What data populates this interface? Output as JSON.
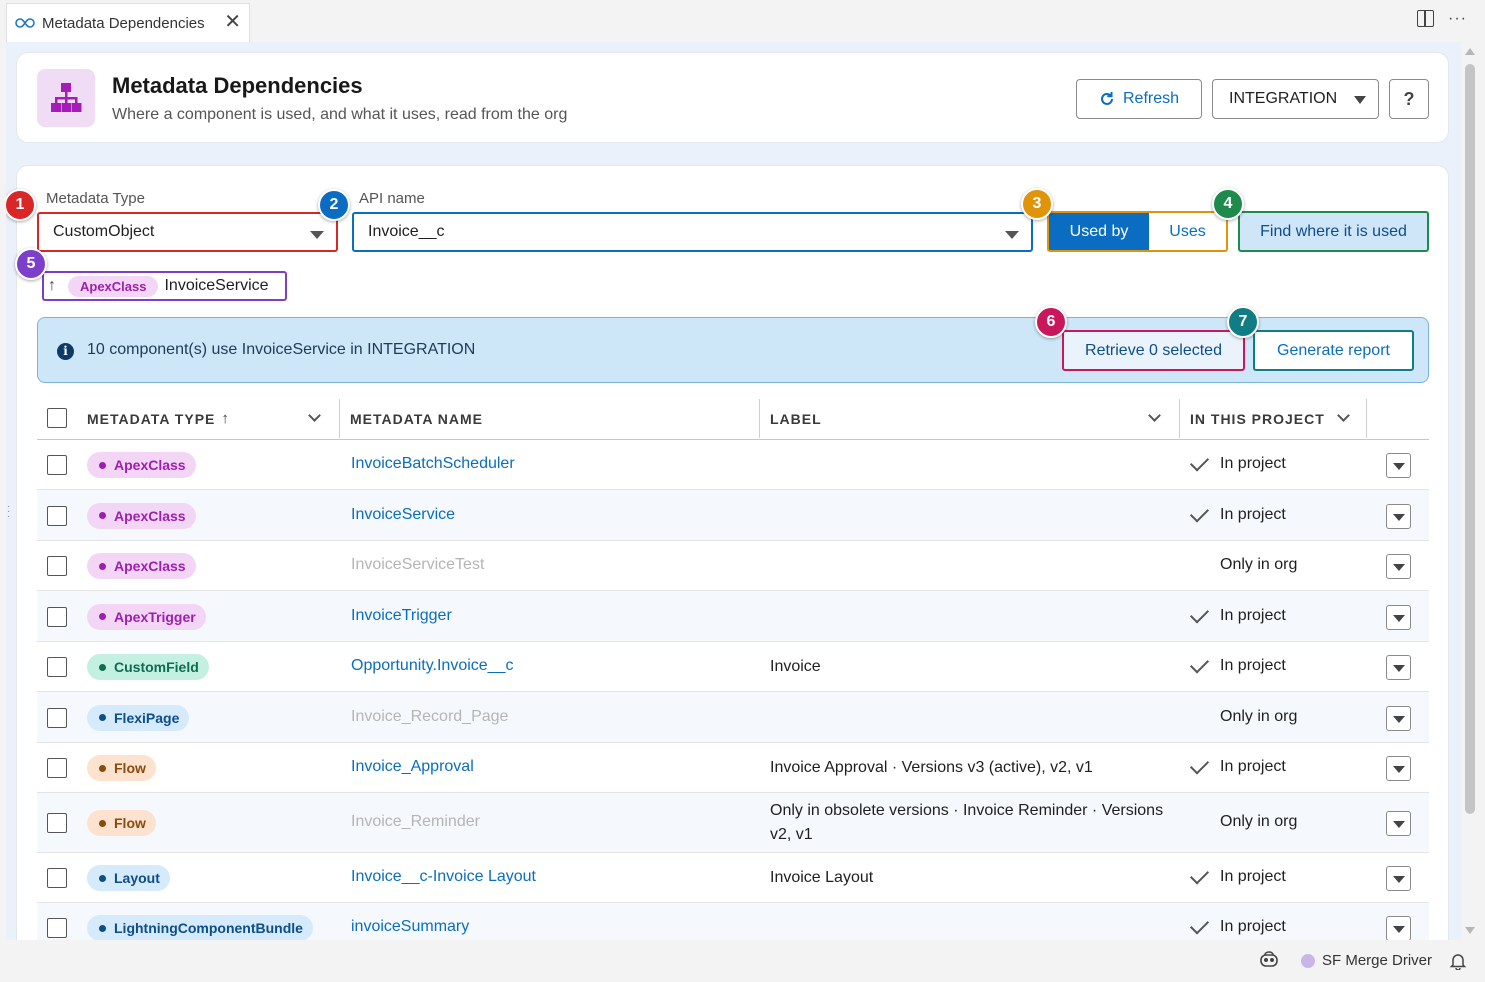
{
  "tab": {
    "title": "Metadata Dependencies",
    "close": "✕"
  },
  "header": {
    "title": "Metadata Dependencies",
    "subtitle": "Where a component is used, and what it uses, read from the org",
    "refresh_label": "Refresh",
    "org_value": "INTEGRATION",
    "help_label": "?"
  },
  "filters": {
    "metadata_type_label": "Metadata Type",
    "metadata_type_value": "CustomObject",
    "api_name_label": "API name",
    "api_name_value": "Invoice__c",
    "used_by_label": "Used by",
    "uses_label": "Uses",
    "find_label": "Find where it is used"
  },
  "breadcrumb": {
    "arrow": "↑",
    "type": "ApexClass",
    "name": "InvoiceService"
  },
  "info": {
    "text": "10 component(s) use InvoiceService in INTEGRATION",
    "retrieve_label": "Retrieve 0 selected",
    "report_label": "Generate report"
  },
  "badges": [
    "1",
    "2",
    "3",
    "4",
    "5",
    "6",
    "7"
  ],
  "badge_colors": [
    "#d92626",
    "#0a6dc2",
    "#e0940a",
    "#1e8a4c",
    "#7c3fc9",
    "#c8175a",
    "#0f7d83"
  ],
  "table": {
    "headers": {
      "type": "METADATA TYPE",
      "type_sort": "↑",
      "name": "METADATA NAME",
      "label": "LABEL",
      "project": "IN THIS PROJECT"
    },
    "rows": [
      {
        "type": "ApexClass",
        "name": "InvoiceBatchScheduler",
        "label": "",
        "project": "In project",
        "in_project": true,
        "muted": false
      },
      {
        "type": "ApexClass",
        "name": "InvoiceService",
        "label": "",
        "project": "In project",
        "in_project": true,
        "muted": false
      },
      {
        "type": "ApexClass",
        "name": "InvoiceServiceTest",
        "label": "",
        "project": "Only in org",
        "in_project": false,
        "muted": true
      },
      {
        "type": "ApexTrigger",
        "name": "InvoiceTrigger",
        "label": "",
        "project": "In project",
        "in_project": true,
        "muted": false
      },
      {
        "type": "CustomField",
        "name": "Opportunity.Invoice__c",
        "label": "Invoice",
        "project": "In project",
        "in_project": true,
        "muted": false
      },
      {
        "type": "FlexiPage",
        "name": "Invoice_Record_Page",
        "label": "",
        "project": "Only in org",
        "in_project": false,
        "muted": true
      },
      {
        "type": "Flow",
        "name": "Invoice_Approval",
        "label": "Invoice Approval · Versions v3 (active), v2, v1",
        "project": "In project",
        "in_project": true,
        "muted": false
      },
      {
        "type": "Flow",
        "name": "Invoice_Reminder",
        "label": "Only in obsolete versions · Invoice Reminder · Versions v2, v1",
        "project": "Only in org",
        "in_project": false,
        "muted": true
      },
      {
        "type": "Layout",
        "name": "Invoice__c-Invoice Layout",
        "label": "Invoice Layout",
        "project": "In project",
        "in_project": true,
        "muted": false
      },
      {
        "type": "LightningComponentBundle",
        "name": "invoiceSummary",
        "label": "",
        "project": "In project",
        "in_project": true,
        "muted": false
      }
    ]
  },
  "type_colors": {
    "ApexClass": {
      "bg": "#f3d6f6",
      "fg": "#9c1faf"
    },
    "ApexTrigger": {
      "bg": "#f3d6f6",
      "fg": "#9c1faf"
    },
    "CustomField": {
      "bg": "#c4f0e2",
      "fg": "#0b6e4f"
    },
    "FlexiPage": {
      "bg": "#d5eafa",
      "fg": "#0d4d8a"
    },
    "Flow": {
      "bg": "#fde3cf",
      "fg": "#8a4b0b"
    },
    "Layout": {
      "bg": "#d5eafa",
      "fg": "#0d4d8a"
    },
    "LightningComponentBundle": {
      "bg": "#d5eafa",
      "fg": "#0d4d8a"
    }
  },
  "statusbar": {
    "merge_label": "SF Merge Driver"
  }
}
